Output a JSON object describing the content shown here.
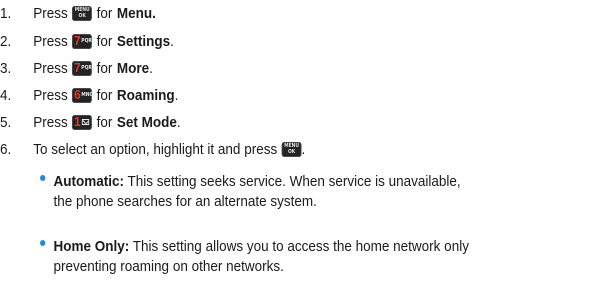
{
  "steps": [
    {
      "number": "1.",
      "before": "Press",
      "key": {
        "type": "menu",
        "line1": "MENU",
        "line2": "OK"
      },
      "after": "for",
      "target": "Menu.",
      "end": ""
    },
    {
      "number": "2.",
      "before": "Press",
      "key": {
        "type": "num",
        "digit": "7",
        "letters": "PQRS"
      },
      "after": "for",
      "target": "Settings",
      "end": "."
    },
    {
      "number": "3.",
      "before": "Press",
      "key": {
        "type": "num",
        "digit": "7",
        "letters": "PQRS"
      },
      "after": "for",
      "target": "More",
      "end": "."
    },
    {
      "number": "4.",
      "before": "Press",
      "key": {
        "type": "num",
        "digit": "6",
        "letters": "MNO"
      },
      "after": "for",
      "target": "Roaming",
      "end": "."
    },
    {
      "number": "5.",
      "before": "Press",
      "key": {
        "type": "num",
        "digit": "1",
        "letters": ""
      },
      "after": "for",
      "target": "Set Mode",
      "end": "."
    },
    {
      "number": "6.",
      "before": "To select an option, highlight it and press",
      "key": {
        "type": "menu",
        "line1": "MENU",
        "line2": "OK"
      },
      "after": "",
      "target": "",
      "end": "."
    }
  ],
  "options": [
    {
      "term": "Automatic:",
      "lines": [
        "This setting seeks service. When service is unavailable,",
        "the phone searches for an alternate system."
      ]
    },
    {
      "term": "Home Only:",
      "lines": [
        "This setting allows you to access the home network only",
        "preventing roaming on other networks."
      ]
    }
  ]
}
